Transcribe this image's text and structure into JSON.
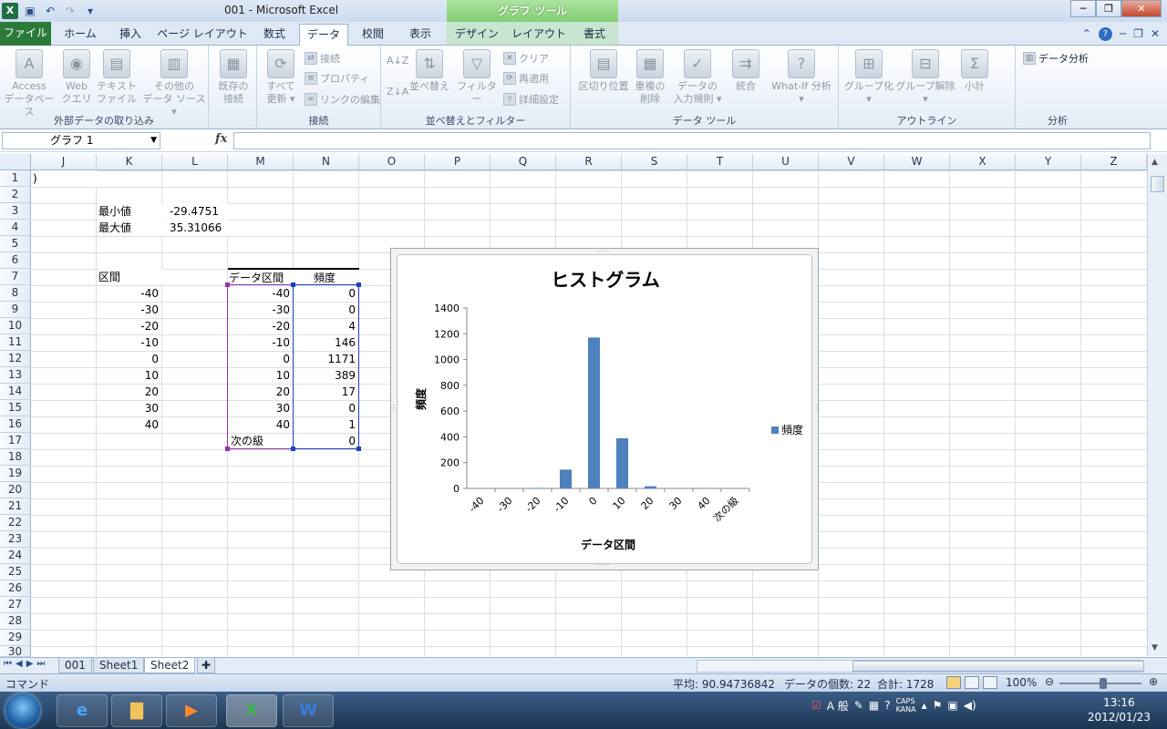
{
  "window": {
    "title": "001  -  Microsoft Excel",
    "context_tab_group": "グラフ ツール",
    "min": "─",
    "restore": "❐",
    "close": "✕"
  },
  "ribbon_tabs": [
    "ファイル",
    "ホーム",
    "挿入",
    "ページ レイアウト",
    "数式",
    "データ",
    "校閲",
    "表示",
    "デザイン",
    "レイアウト",
    "書式"
  ],
  "ribbon": {
    "groups": {
      "external": "外部データの取り込み",
      "connections": "接続",
      "sort_filter": "並べ替えとフィルター",
      "data_tools": "データ ツール",
      "outline": "アウトライン",
      "analysis": "分析"
    },
    "buttons": {
      "access": [
        "Access",
        "データベース"
      ],
      "web": [
        "Web",
        "クエリ"
      ],
      "text": [
        "テキスト",
        "ファイル"
      ],
      "other": [
        "その他の",
        "データ ソース ▾"
      ],
      "existing": [
        "既存の",
        "接続"
      ],
      "refresh": [
        "すべて",
        "更新 ▾"
      ],
      "conn": "接続",
      "props": "プロパティ",
      "editlinks": "リンクの編集",
      "sort_az": "A↓Z",
      "sort_za": "Z↓A",
      "sort": "並べ替え",
      "filter": "フィルター",
      "clear": "クリア",
      "reapply": "再適用",
      "advanced": "詳細設定",
      "text_to_cols": "区切り位置",
      "remove_dup": [
        "重複の",
        "削除"
      ],
      "validation": [
        "データの",
        "入力規則 ▾"
      ],
      "consolidate": "統合",
      "whatif": [
        "What-If 分析",
        "▾"
      ],
      "group": [
        "グループ化",
        "▾"
      ],
      "ungroup": [
        "グループ解除",
        "▾"
      ],
      "subtotal": "小計",
      "data_analysis": "データ分析"
    }
  },
  "formula_bar": {
    "name_box": "グラフ 1",
    "fx": "fx",
    "formula": ""
  },
  "columns": [
    "J",
    "K",
    "L",
    "M",
    "N",
    "O",
    "P",
    "Q",
    "R",
    "S",
    "T",
    "U",
    "V",
    "W",
    "X",
    "Y",
    "Z"
  ],
  "rows": [
    "1",
    "2",
    "3",
    "4",
    "5",
    "6",
    "7",
    "8",
    "9",
    "10",
    "11",
    "12",
    "13",
    "14",
    "15",
    "16",
    "17",
    "18",
    "19",
    "20",
    "21",
    "22",
    "23",
    "24",
    "25",
    "26",
    "27",
    "28",
    "29",
    "30"
  ],
  "cells": {
    "j1": ")",
    "k3": "最小値",
    "l3": "-29.4751",
    "k4": "最大値",
    "l4": "35.31066",
    "k7": "区間",
    "m7": "データ区間",
    "n7": "頻度",
    "k_bins": [
      "-40",
      "-30",
      "-20",
      "-10",
      "0",
      "10",
      "20",
      "30",
      "40"
    ],
    "m_bins": [
      "-40",
      "-30",
      "-20",
      "-10",
      "0",
      "10",
      "20",
      "30",
      "40",
      "次の級"
    ],
    "n_freq": [
      "0",
      "0",
      "4",
      "146",
      "1171",
      "389",
      "17",
      "0",
      "1",
      "0"
    ]
  },
  "chart_data": {
    "type": "bar",
    "title": "ヒストグラム",
    "xlabel": "データ区間",
    "ylabel": "頻度",
    "categories": [
      "-40",
      "-30",
      "-20",
      "-10",
      "0",
      "10",
      "20",
      "30",
      "40",
      "次の級"
    ],
    "series": [
      {
        "name": "頻度",
        "values": [
          0,
          0,
          4,
          146,
          1171,
          389,
          17,
          0,
          1,
          0
        ],
        "color": "#4f81bd"
      }
    ],
    "ylim": [
      0,
      1400
    ],
    "yticks": [
      "0",
      "200",
      "400",
      "600",
      "800",
      "1000",
      "1200",
      "1400"
    ],
    "legend": "right",
    "grid": false
  },
  "sheets": [
    "001",
    "Sheet1",
    "Sheet2"
  ],
  "active_sheet": "Sheet2",
  "status": {
    "mode": "コマンド",
    "average": "平均: 90.94736842",
    "count": "データの個数: 22",
    "sum": "合計: 1728",
    "zoom": "100%"
  },
  "taskbar": {
    "time": "13:16",
    "date": "2012/01/23",
    "ime": "A 般",
    "caps": "CAPS",
    "kana": "KANA"
  }
}
